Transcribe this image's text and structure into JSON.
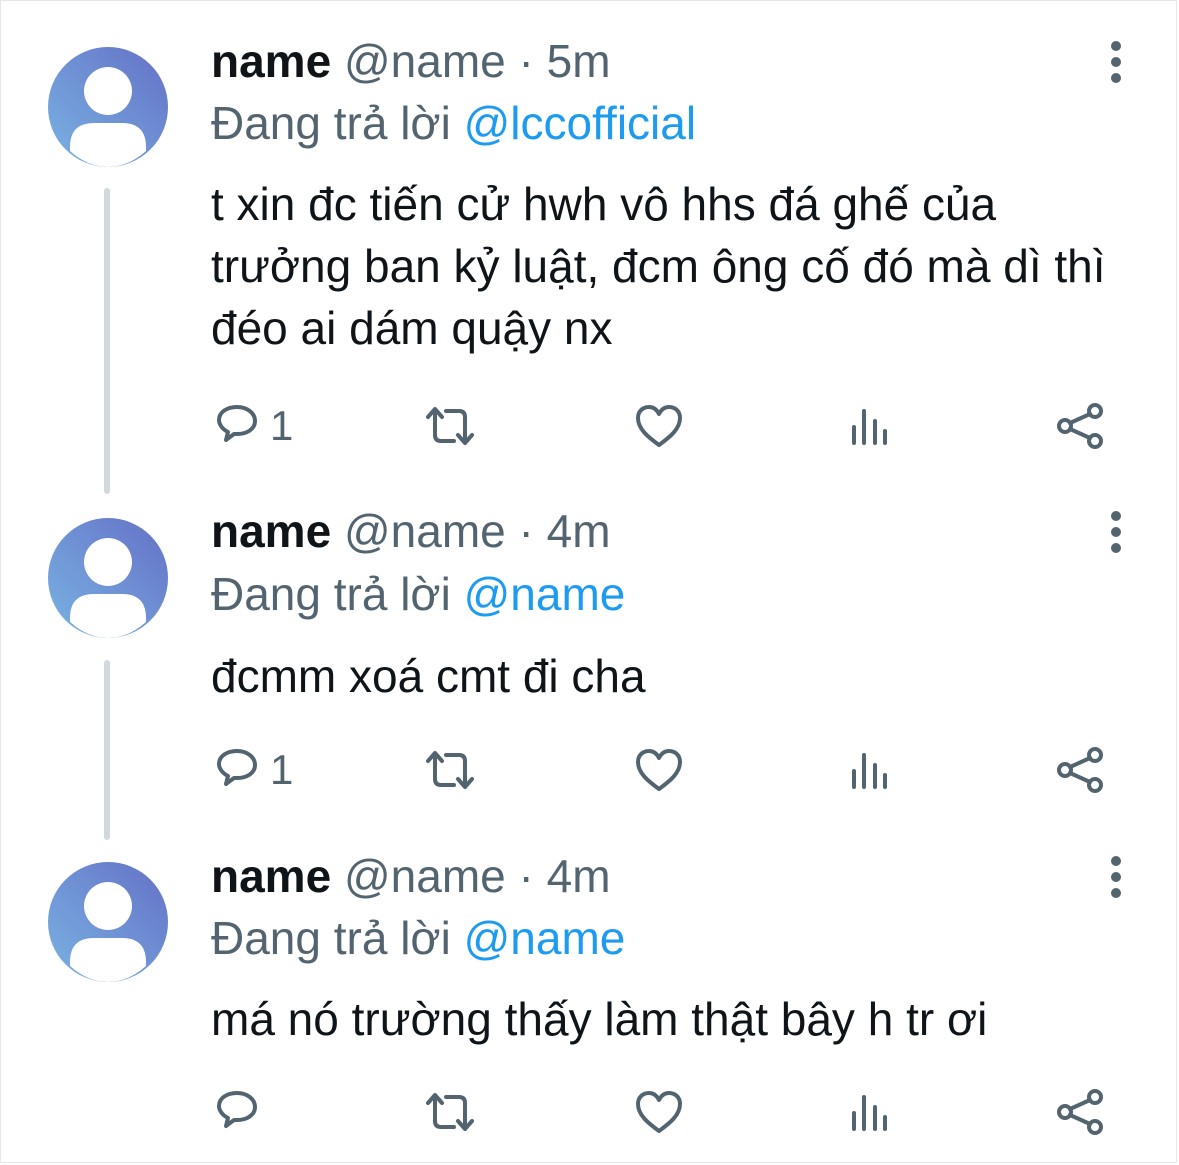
{
  "colors": {
    "text": "#0f1419",
    "secondary": "#536471",
    "mention": "#1d9bf0",
    "thread_line": "#cfd9de",
    "avatar_gradient_start": "#76aee0",
    "avatar_gradient_end": "#6872c8"
  },
  "tweets": [
    {
      "display_name": "name",
      "handle": "@name",
      "separator": "·",
      "time": "5m",
      "reply_prefix": "Đang trả lời",
      "reply_to": "@lccofficial",
      "text": "t xin đc tiến cử hwh vô hhs đá ghế của trưởng ban kỷ luật, đcm ông cố đó mà dì thì đéo ai dám quậy nx",
      "reply_count": "1",
      "icons": [
        "avatar-placeholder-icon",
        "more-vertical-icon",
        "reply-icon",
        "retweet-icon",
        "like-icon",
        "views-icon",
        "share-icon"
      ]
    },
    {
      "display_name": "name",
      "handle": "@name",
      "separator": "·",
      "time": "4m",
      "reply_prefix": "Đang trả lời",
      "reply_to": "@name",
      "text": "đcmm xoá cmt đi cha",
      "reply_count": "1",
      "icons": [
        "avatar-placeholder-icon",
        "more-vertical-icon",
        "reply-icon",
        "retweet-icon",
        "like-icon",
        "views-icon",
        "share-icon"
      ]
    },
    {
      "display_name": "name",
      "handle": "@name",
      "separator": "·",
      "time": "4m",
      "reply_prefix": "Đang trả lời",
      "reply_to": "@name",
      "text": "má nó trường thấy làm thật bây h tr ơi",
      "reply_count": "",
      "icons": [
        "avatar-placeholder-icon",
        "more-vertical-icon",
        "reply-icon",
        "retweet-icon",
        "like-icon",
        "views-icon",
        "share-icon"
      ]
    }
  ]
}
